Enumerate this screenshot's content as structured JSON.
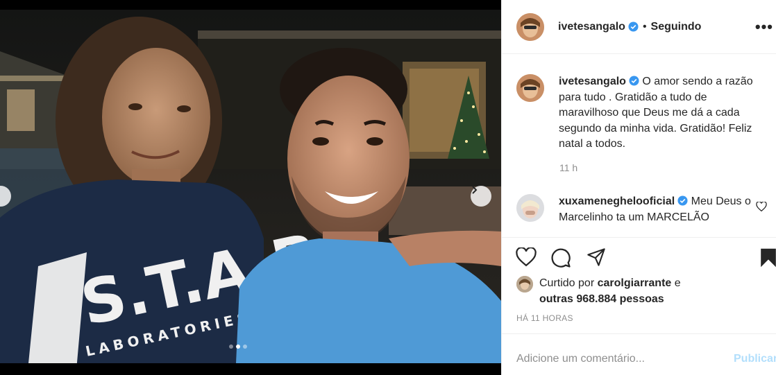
{
  "post": {
    "author": "ivetesangalo",
    "follow_separator": "•",
    "follow_label": "Seguindo",
    "more_icon": "•••"
  },
  "caption": {
    "author": "ivetesangalo",
    "text": "O amor sendo a razão para tudo . Gratidão a tudo de maravilhoso que Deus me dá a cada segundo da minha vida. Gratidão! Feliz natal a todos.",
    "time": "11 h"
  },
  "comments": [
    {
      "author": "xuxameneghelooficial",
      "text": "Meu Deus o Marcelinho ta um MARCELÃO"
    }
  ],
  "likes": {
    "prefix": "Curtido por ",
    "user": "carolgiarrante",
    "middle": " e",
    "others": "outras 968.884 pessoas"
  },
  "time_ago": "HÁ 11 HORAS",
  "comment_box": {
    "placeholder": "Adicione um comentário...",
    "publish": "Publicar"
  },
  "carousel": {
    "count": 3,
    "active": 1
  },
  "colors": {
    "verified": "#3897f0",
    "link_disabled": "#b2dffc",
    "muted": "#8e8e8e"
  }
}
